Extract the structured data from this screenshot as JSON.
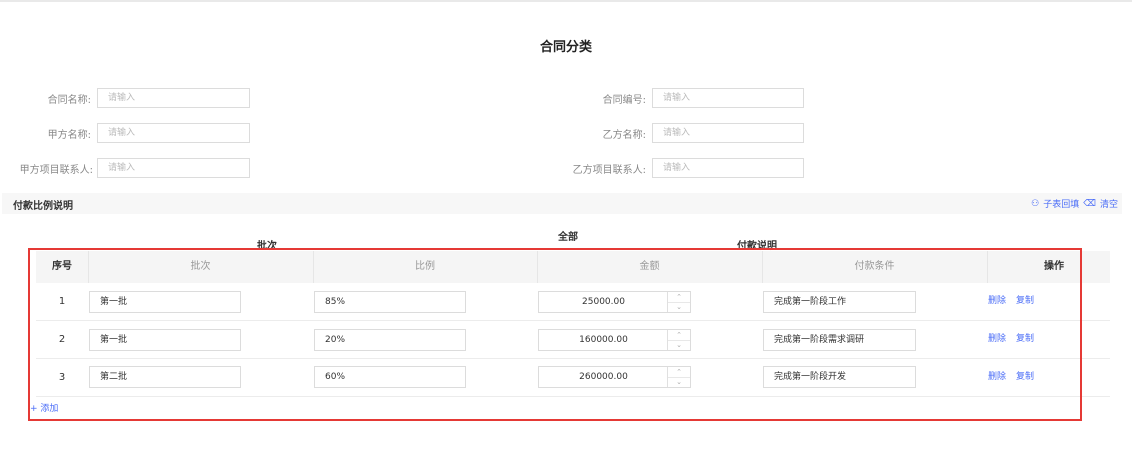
{
  "page": {
    "title": "合同分类"
  },
  "form": {
    "contract_name": {
      "label": "合同名称:",
      "placeholder": "请输入"
    },
    "contract_no": {
      "label": "合同编号:",
      "placeholder": "请输入"
    },
    "party_a_name": {
      "label": "甲方名称:",
      "placeholder": "请输入"
    },
    "party_b_name": {
      "label": "乙方名称:",
      "placeholder": "请输入"
    },
    "party_a_contact": {
      "label": "甲方项目联系人:",
      "placeholder": "请输入"
    },
    "party_b_contact": {
      "label": "乙方项目联系人:",
      "placeholder": "请输入"
    }
  },
  "section": {
    "title": "付款比例说明",
    "child_fill": "子表回填",
    "clear": "清空",
    "group_all": "全部",
    "group_batch": "批次",
    "group_payment": "付款说明"
  },
  "table": {
    "headers": [
      "序号",
      "批次",
      "比例",
      "金额",
      "付款条件",
      "操作"
    ],
    "rows": [
      {
        "index": "1",
        "batch": "第一批",
        "ratio": "85%",
        "amount": "25000.00",
        "condition": "完成第一阶段工作"
      },
      {
        "index": "2",
        "batch": "第一批",
        "ratio": "20%",
        "amount": "160000.00",
        "condition": "完成第一阶段需求调研"
      },
      {
        "index": "3",
        "batch": "第二批",
        "ratio": "60%",
        "amount": "260000.00",
        "condition": "完成第一阶段开发"
      }
    ],
    "action_delete": "删除",
    "action_copy": "复制",
    "add_label": "+ 添加"
  },
  "icons": {
    "child_fill": "users-icon",
    "clear": "trash-icon",
    "spin_up": "chevron-up-icon",
    "spin_down": "chevron-down-icon"
  },
  "colors": {
    "accent": "#4a6cf7",
    "highlight": "#e53935"
  }
}
